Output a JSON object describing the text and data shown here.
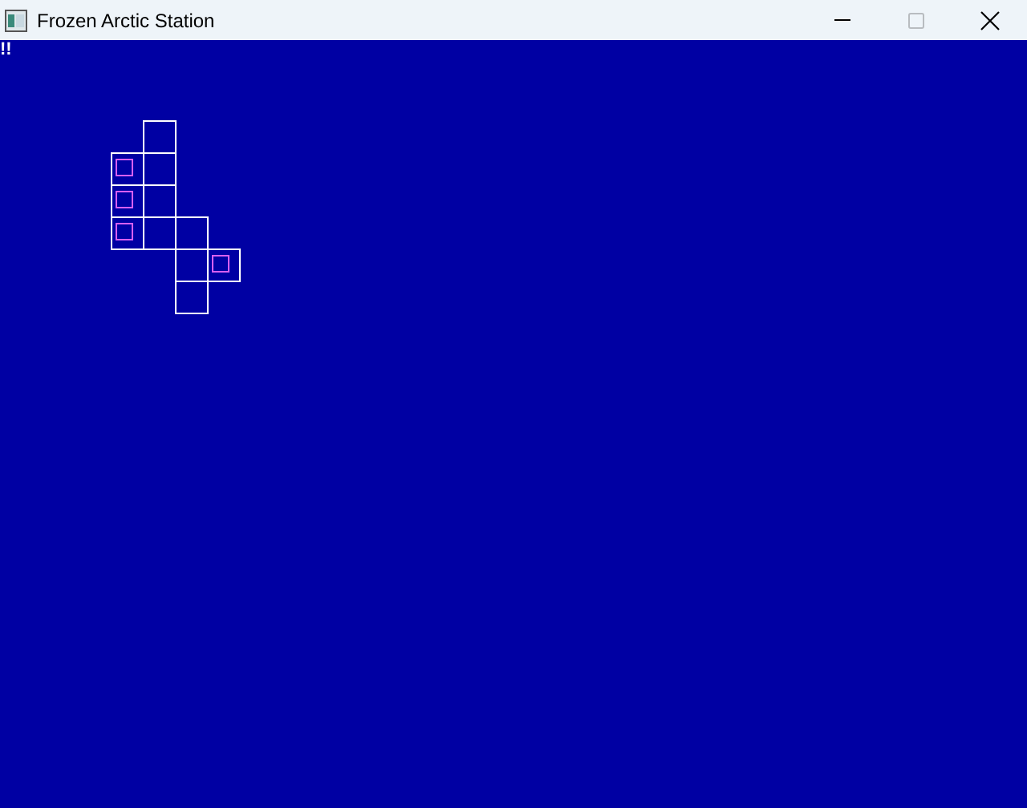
{
  "window": {
    "title": "Frozen Arctic Station",
    "maximize_disabled": true
  },
  "status_text": "!!",
  "map": {
    "rows": [
      {
        "cells": [
          {
            "kind": "empty"
          },
          {
            "kind": "room",
            "marked": false
          }
        ]
      },
      {
        "cells": [
          {
            "kind": "room",
            "marked": true
          },
          {
            "kind": "room",
            "marked": false
          }
        ]
      },
      {
        "cells": [
          {
            "kind": "room",
            "marked": true
          },
          {
            "kind": "room",
            "marked": false
          }
        ]
      },
      {
        "cells": [
          {
            "kind": "room",
            "marked": true
          },
          {
            "kind": "room",
            "marked": false
          },
          {
            "kind": "room",
            "marked": false
          }
        ]
      },
      {
        "cells": [
          {
            "kind": "empty"
          },
          {
            "kind": "empty"
          },
          {
            "kind": "room",
            "marked": false
          },
          {
            "kind": "room",
            "marked": true
          }
        ]
      },
      {
        "cells": [
          {
            "kind": "empty"
          },
          {
            "kind": "empty"
          },
          {
            "kind": "room",
            "marked": false
          }
        ]
      }
    ]
  }
}
